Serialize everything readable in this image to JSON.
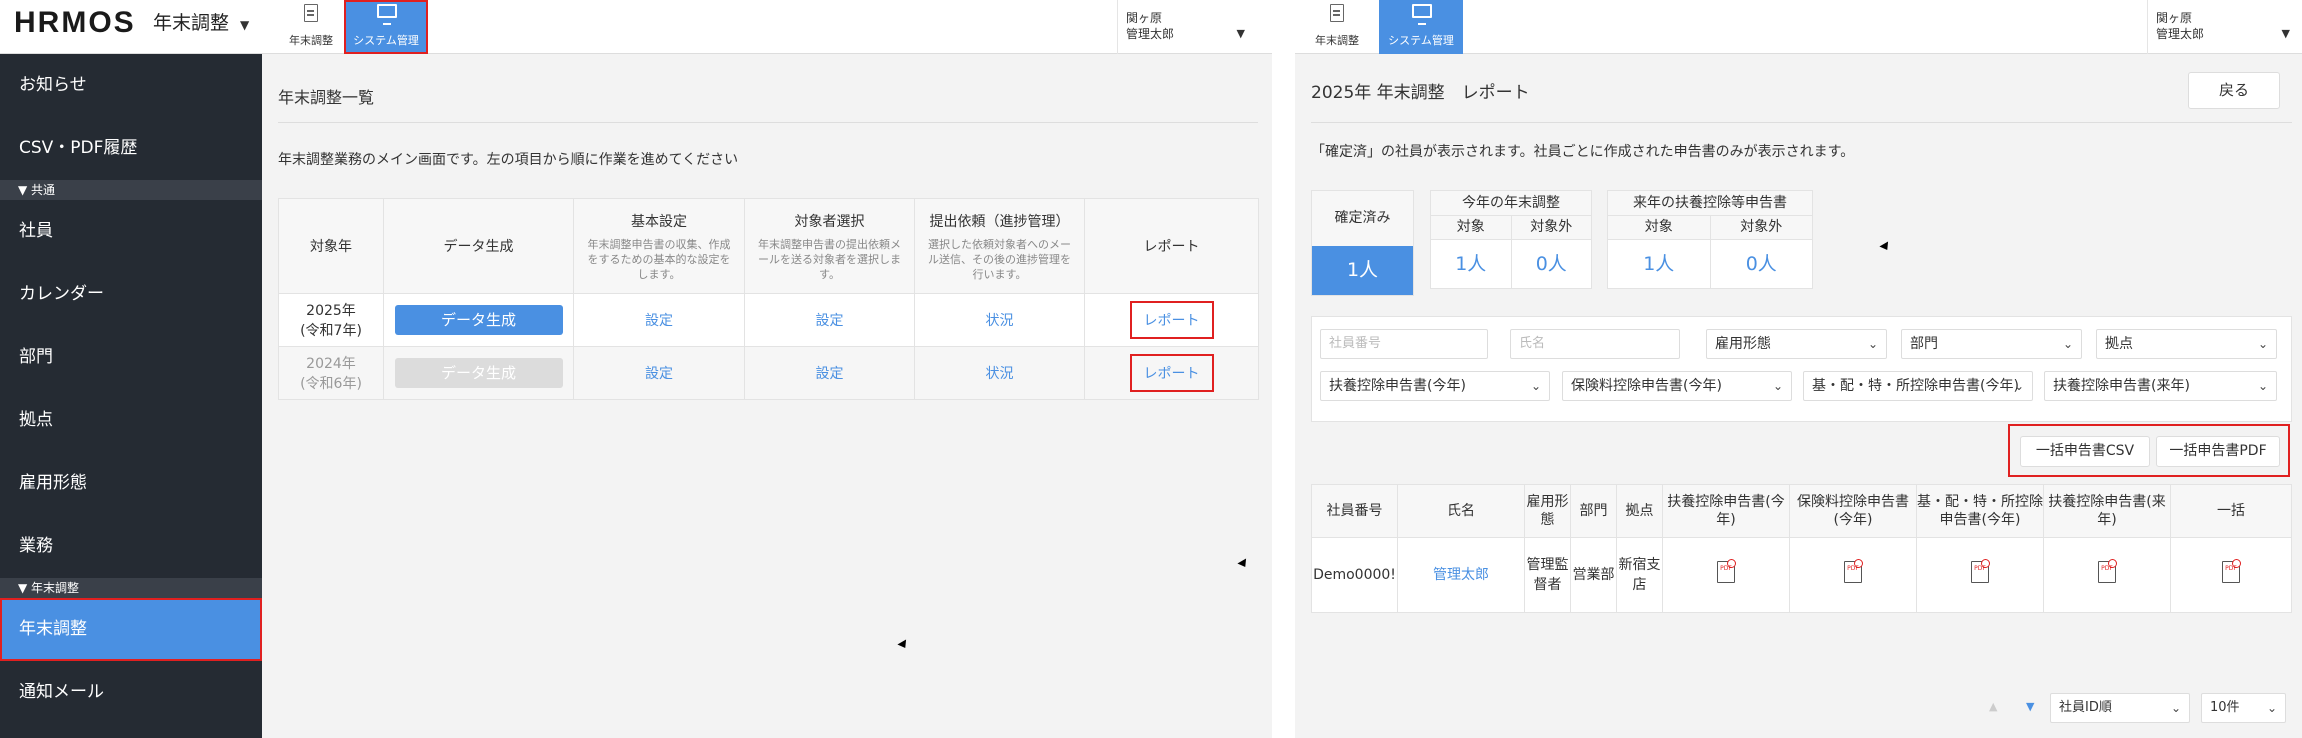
{
  "left": {
    "logo": "HRMOS",
    "app_name": "年末調整",
    "tabs": [
      {
        "label": "年末調整",
        "icon": "document-icon"
      },
      {
        "label": "システム管理",
        "icon": "monitor-icon"
      }
    ],
    "user": {
      "line1": "関ヶ原",
      "line2": "管理太郎"
    },
    "sidebar": {
      "items": [
        {
          "label": "お知らせ"
        },
        {
          "label": "CSV・PDF履歴"
        }
      ],
      "section_common": "▼ 共通",
      "common_items": [
        {
          "label": "社員"
        },
        {
          "label": "カレンダー"
        },
        {
          "label": "部門"
        },
        {
          "label": "拠点"
        },
        {
          "label": "雇用形態"
        },
        {
          "label": "業務"
        }
      ],
      "section_yearend": "▼ 年末調整",
      "yearend_items": [
        {
          "label": "年末調整"
        },
        {
          "label": "通知メール"
        }
      ]
    },
    "page_title": "年末調整一覧",
    "description": "年末調整業務のメイン画面です。左の項目から順に作業を進めてください",
    "table": {
      "headers": {
        "year": "対象年",
        "datagen": "データ生成",
        "basic": "基本設定",
        "basic_sub": "年末調整申告書の収集、作成をするための基本的な設定をします。",
        "target": "対象者選択",
        "target_sub": "年末調整申告書の提出依頼メールを送る対象者を選択します。",
        "request": "提出依頼（進捗管理）",
        "request_sub": "選択した依頼対象者へのメール送信、その後の進捗管理を行います。",
        "report": "レポート"
      },
      "rows": [
        {
          "year": "2025年",
          "era": "(令和7年)",
          "datagen": "データ生成",
          "basic": "設定",
          "target": "設定",
          "request": "状況",
          "report": "レポート"
        },
        {
          "year": "2024年",
          "era": "(令和6年)",
          "datagen": "データ生成",
          "basic": "設定",
          "target": "設定",
          "request": "状況",
          "report": "レポート"
        }
      ]
    }
  },
  "right": {
    "tabs": [
      {
        "label": "年末調整",
        "icon": "document-icon"
      },
      {
        "label": "システム管理",
        "icon": "monitor-icon"
      }
    ],
    "user": {
      "line1": "関ヶ原",
      "line2": "管理太郎"
    },
    "title": "2025年 年末調整　レポート",
    "back_button": "戻る",
    "description": "「確定済」の社員が表示されます。社員ごとに作成された申告書のみが表示されます。",
    "stats": {
      "confirmed_label": "確定済み",
      "confirmed_value": "1人",
      "this_year_label": "今年の年末調整",
      "next_year_label": "来年の扶養控除等申告書",
      "target_label": "対象",
      "non_target_label": "対象外",
      "this_year_target": "1人",
      "this_year_non_target": "0人",
      "next_year_target": "1人",
      "next_year_non_target": "0人"
    },
    "filters": {
      "employee_no_placeholder": "社員番号",
      "name_placeholder": "氏名",
      "employment_type": "雇用形態",
      "department": "部門",
      "location": "拠点",
      "dependent_this_year": "扶養控除申告書(今年)",
      "insurance_this_year": "保険料控除申告書(今年)",
      "basic_this_year": "基・配・特・所控除申告書(今年)",
      "dependent_next_year": "扶養控除申告書(来年)"
    },
    "bulk_csv": "一括申告書CSV",
    "bulk_pdf": "一括申告書PDF",
    "table": {
      "headers": {
        "emp_no": "社員番号",
        "name": "氏名",
        "employment": "雇用形態",
        "department": "部門",
        "location": "拠点",
        "dependent_this": "扶養控除申告書(今年)",
        "insurance": "保険料控除申告書(今年)",
        "basic": "基・配・特・所控除申告書(今年)",
        "dependent_next": "扶養控除申告書(来年)",
        "bulk": "一括"
      },
      "rows": [
        {
          "emp_no": "Demo0000!",
          "name": "管理太郎",
          "employment": "管理監督者",
          "department": "営業部",
          "location": "新宿支店"
        }
      ]
    },
    "pager": {
      "sort": "社員ID順",
      "per_page": "10件"
    }
  }
}
